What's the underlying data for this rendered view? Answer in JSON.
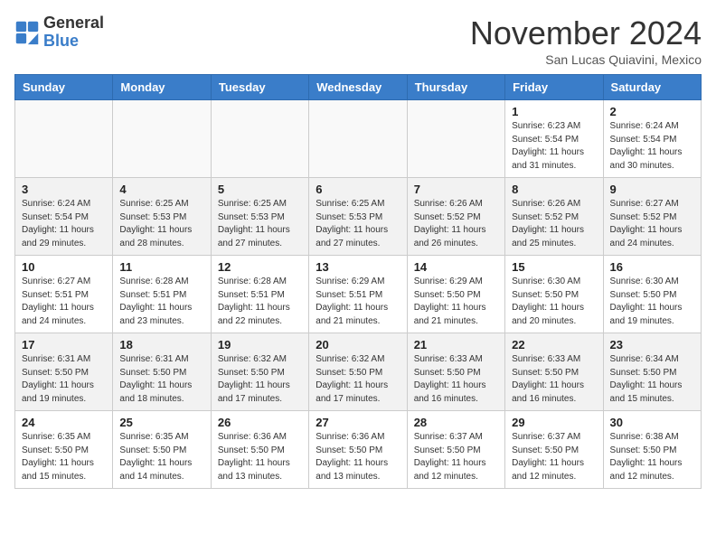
{
  "header": {
    "logo_line1": "General",
    "logo_line2": "Blue",
    "month": "November 2024",
    "location": "San Lucas Quiavini, Mexico"
  },
  "weekdays": [
    "Sunday",
    "Monday",
    "Tuesday",
    "Wednesday",
    "Thursday",
    "Friday",
    "Saturday"
  ],
  "weeks": [
    [
      {
        "day": "",
        "info": ""
      },
      {
        "day": "",
        "info": ""
      },
      {
        "day": "",
        "info": ""
      },
      {
        "day": "",
        "info": ""
      },
      {
        "day": "",
        "info": ""
      },
      {
        "day": "1",
        "info": "Sunrise: 6:23 AM\nSunset: 5:54 PM\nDaylight: 11 hours and 31 minutes."
      },
      {
        "day": "2",
        "info": "Sunrise: 6:24 AM\nSunset: 5:54 PM\nDaylight: 11 hours and 30 minutes."
      }
    ],
    [
      {
        "day": "3",
        "info": "Sunrise: 6:24 AM\nSunset: 5:54 PM\nDaylight: 11 hours and 29 minutes."
      },
      {
        "day": "4",
        "info": "Sunrise: 6:25 AM\nSunset: 5:53 PM\nDaylight: 11 hours and 28 minutes."
      },
      {
        "day": "5",
        "info": "Sunrise: 6:25 AM\nSunset: 5:53 PM\nDaylight: 11 hours and 27 minutes."
      },
      {
        "day": "6",
        "info": "Sunrise: 6:25 AM\nSunset: 5:53 PM\nDaylight: 11 hours and 27 minutes."
      },
      {
        "day": "7",
        "info": "Sunrise: 6:26 AM\nSunset: 5:52 PM\nDaylight: 11 hours and 26 minutes."
      },
      {
        "day": "8",
        "info": "Sunrise: 6:26 AM\nSunset: 5:52 PM\nDaylight: 11 hours and 25 minutes."
      },
      {
        "day": "9",
        "info": "Sunrise: 6:27 AM\nSunset: 5:52 PM\nDaylight: 11 hours and 24 minutes."
      }
    ],
    [
      {
        "day": "10",
        "info": "Sunrise: 6:27 AM\nSunset: 5:51 PM\nDaylight: 11 hours and 24 minutes."
      },
      {
        "day": "11",
        "info": "Sunrise: 6:28 AM\nSunset: 5:51 PM\nDaylight: 11 hours and 23 minutes."
      },
      {
        "day": "12",
        "info": "Sunrise: 6:28 AM\nSunset: 5:51 PM\nDaylight: 11 hours and 22 minutes."
      },
      {
        "day": "13",
        "info": "Sunrise: 6:29 AM\nSunset: 5:51 PM\nDaylight: 11 hours and 21 minutes."
      },
      {
        "day": "14",
        "info": "Sunrise: 6:29 AM\nSunset: 5:50 PM\nDaylight: 11 hours and 21 minutes."
      },
      {
        "day": "15",
        "info": "Sunrise: 6:30 AM\nSunset: 5:50 PM\nDaylight: 11 hours and 20 minutes."
      },
      {
        "day": "16",
        "info": "Sunrise: 6:30 AM\nSunset: 5:50 PM\nDaylight: 11 hours and 19 minutes."
      }
    ],
    [
      {
        "day": "17",
        "info": "Sunrise: 6:31 AM\nSunset: 5:50 PM\nDaylight: 11 hours and 19 minutes."
      },
      {
        "day": "18",
        "info": "Sunrise: 6:31 AM\nSunset: 5:50 PM\nDaylight: 11 hours and 18 minutes."
      },
      {
        "day": "19",
        "info": "Sunrise: 6:32 AM\nSunset: 5:50 PM\nDaylight: 11 hours and 17 minutes."
      },
      {
        "day": "20",
        "info": "Sunrise: 6:32 AM\nSunset: 5:50 PM\nDaylight: 11 hours and 17 minutes."
      },
      {
        "day": "21",
        "info": "Sunrise: 6:33 AM\nSunset: 5:50 PM\nDaylight: 11 hours and 16 minutes."
      },
      {
        "day": "22",
        "info": "Sunrise: 6:33 AM\nSunset: 5:50 PM\nDaylight: 11 hours and 16 minutes."
      },
      {
        "day": "23",
        "info": "Sunrise: 6:34 AM\nSunset: 5:50 PM\nDaylight: 11 hours and 15 minutes."
      }
    ],
    [
      {
        "day": "24",
        "info": "Sunrise: 6:35 AM\nSunset: 5:50 PM\nDaylight: 11 hours and 15 minutes."
      },
      {
        "day": "25",
        "info": "Sunrise: 6:35 AM\nSunset: 5:50 PM\nDaylight: 11 hours and 14 minutes."
      },
      {
        "day": "26",
        "info": "Sunrise: 6:36 AM\nSunset: 5:50 PM\nDaylight: 11 hours and 13 minutes."
      },
      {
        "day": "27",
        "info": "Sunrise: 6:36 AM\nSunset: 5:50 PM\nDaylight: 11 hours and 13 minutes."
      },
      {
        "day": "28",
        "info": "Sunrise: 6:37 AM\nSunset: 5:50 PM\nDaylight: 11 hours and 12 minutes."
      },
      {
        "day": "29",
        "info": "Sunrise: 6:37 AM\nSunset: 5:50 PM\nDaylight: 11 hours and 12 minutes."
      },
      {
        "day": "30",
        "info": "Sunrise: 6:38 AM\nSunset: 5:50 PM\nDaylight: 11 hours and 12 minutes."
      }
    ]
  ]
}
